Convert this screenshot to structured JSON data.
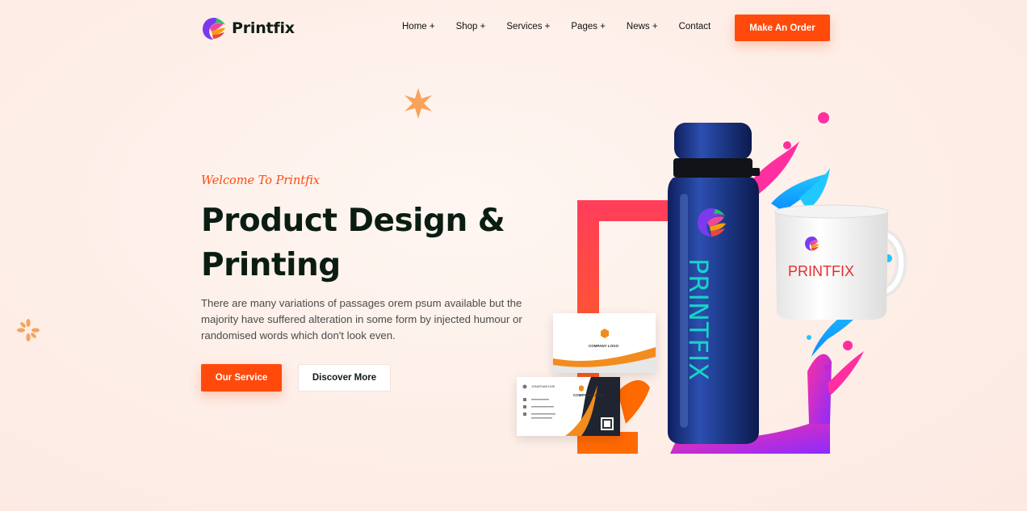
{
  "brand": {
    "name": "Printfix"
  },
  "nav": {
    "items": [
      {
        "label": "Home +"
      },
      {
        "label": "Shop +"
      },
      {
        "label": "Services +"
      },
      {
        "label": "Pages +"
      },
      {
        "label": "News +"
      },
      {
        "label": "Contact"
      }
    ],
    "cta_label": "Make An Order"
  },
  "hero": {
    "eyebrow": "Welcome To Printfix",
    "title_line1": "Product Design &",
    "title_line2": "Printing",
    "description": "There are many variations of passages orem psum available but the majority have suffered alteration in some form by injected humour or randomised words which don't look even.",
    "primary_button": "Our Service",
    "secondary_button": "Discover More"
  },
  "illustration": {
    "bottle_print": "PRINTFIX",
    "mug_print": "PRINTFIX",
    "card_logo_text": "COMPANY LOGO",
    "card_name": "JONATHAN DOE"
  },
  "colors": {
    "accent": "#ff4a0c",
    "heading": "#0b1d12",
    "bottle": "#1e3a8a",
    "teal_print": "#17d4c6",
    "mug_print": "#ea2b2b"
  },
  "icons": [
    "printfix-logo-icon",
    "star-icon"
  ]
}
